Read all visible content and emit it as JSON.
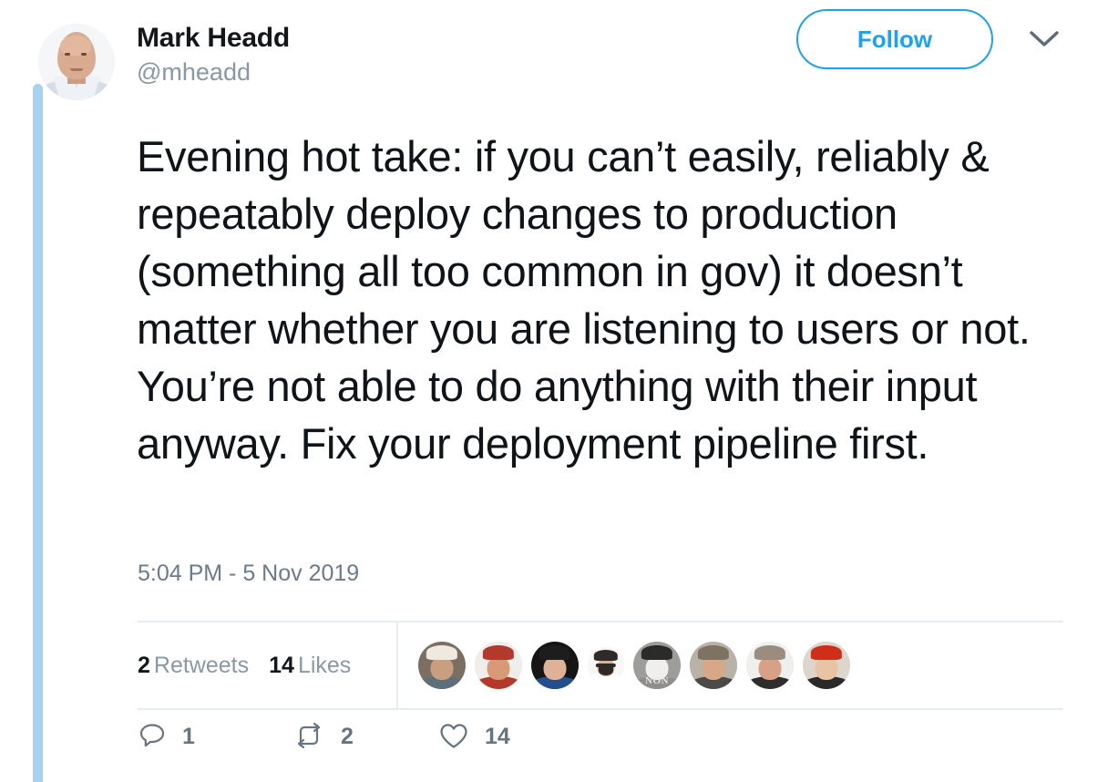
{
  "account": {
    "display_name": "Mark Headd",
    "handle": "@mheadd",
    "avatar_alt": "profile-photo"
  },
  "header": {
    "follow_label": "Follow",
    "caret_icon": "chevron-down-icon"
  },
  "tweet": {
    "text": "Evening hot take: if you can’t easily, reliably & repeatably deploy changes to production (something all too common in gov) it doesn’t matter whether you are listening to users or not. You’re not able to do anything with their input anyway. Fix your deployment pipeline first.",
    "timestamp": "5:04 PM - 5 Nov 2019"
  },
  "stats": {
    "retweets_count": "2",
    "retweets_label": "Retweets",
    "likes_count": "14",
    "likes_label": "Likes"
  },
  "likers": [
    {
      "name": "liker-avatar-1",
      "bg": "#7b6f62",
      "face": "#c99f80",
      "hat": "#efe9df",
      "body": "#5d6f7a"
    },
    {
      "name": "liker-avatar-2",
      "bg": "#efeeec",
      "face": "#d79a74",
      "hat": "#b33a2b",
      "body": "#b33a2b"
    },
    {
      "name": "liker-avatar-3",
      "bg": "#151515",
      "face": "#ddb296",
      "hat": "#1d1d1d",
      "body": "#23508c"
    },
    {
      "name": "liker-avatar-4",
      "bg": "#f7f7f5",
      "face": "#e2ae85",
      "hat": "#2f2a28",
      "body": "#ffffff"
    },
    {
      "name": "liker-avatar-5",
      "bg": "#9d9d9b",
      "face": "#f0efed",
      "hat": "#2b2b2b",
      "body": "#8e8e8c",
      "text": "NON"
    },
    {
      "name": "liker-avatar-6",
      "bg": "#b9b2a6",
      "face": "#d6a886",
      "hat": "#7e7363",
      "body": "#4a4a48"
    },
    {
      "name": "liker-avatar-7",
      "bg": "#efefee",
      "face": "#d6a184",
      "hat": "#9a8d80",
      "body": "#2e2e2e"
    },
    {
      "name": "liker-avatar-8",
      "bg": "#ddd6cc",
      "face": "#e8c3a4",
      "hat": "#cf2f18",
      "body": "#2a2a2a"
    }
  ],
  "actions": {
    "reply": {
      "icon": "reply-icon",
      "count": "1"
    },
    "retweet": {
      "icon": "retweet-icon",
      "count": "2"
    },
    "like": {
      "icon": "heart-icon",
      "count": "14"
    }
  },
  "colors": {
    "accent": "#1da1f2",
    "thread_line": "#a5d3f0",
    "text_primary": "#0f1419",
    "text_muted": "#8899a6",
    "action_gray": "#66757f",
    "divider": "#e6ecf0"
  }
}
